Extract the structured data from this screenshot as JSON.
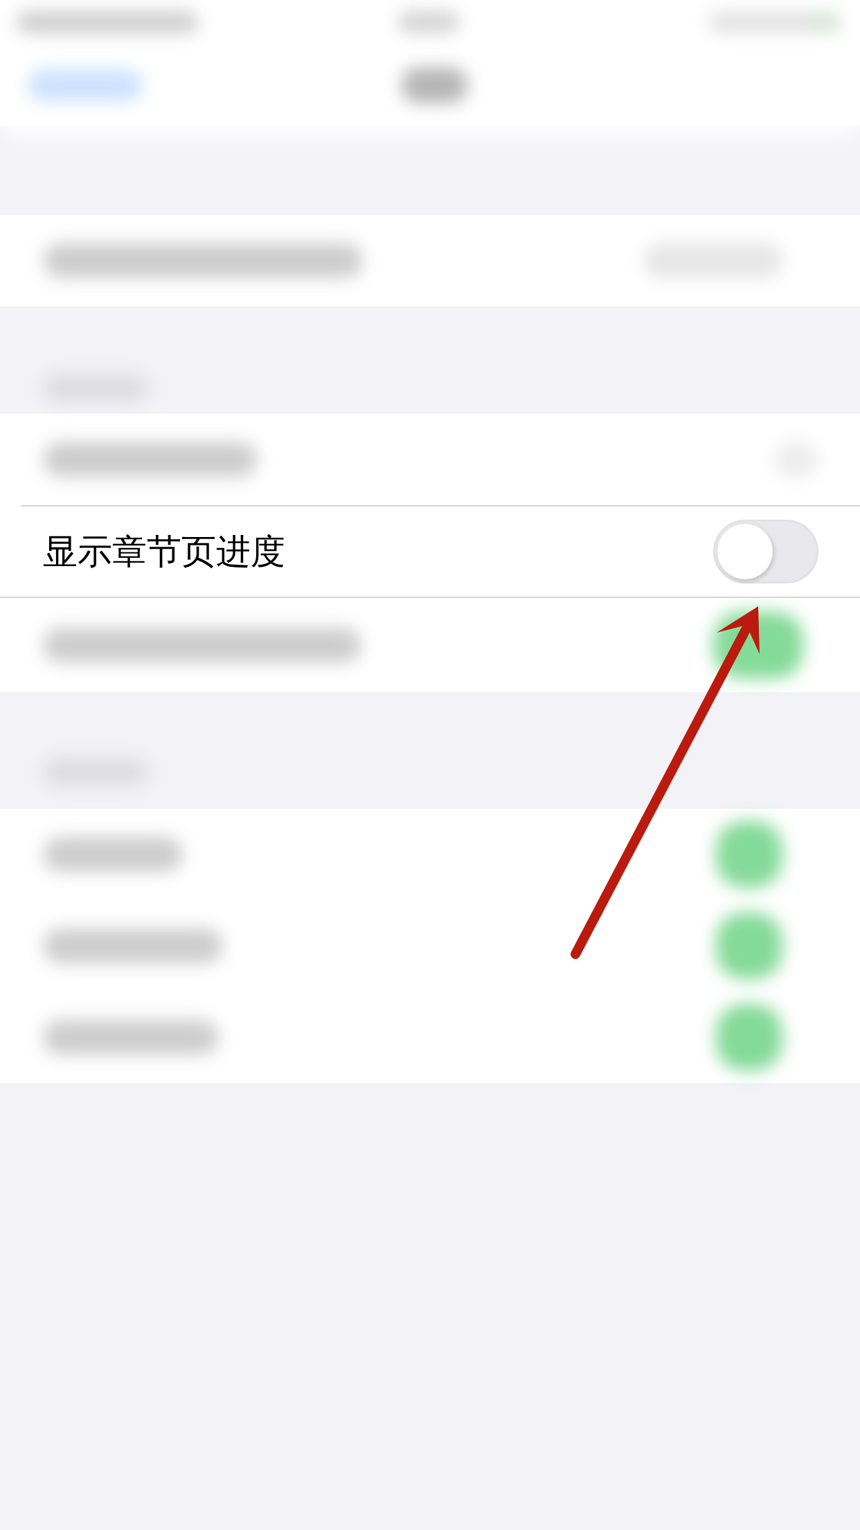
{
  "settings_row": {
    "label": "显示章节页进度",
    "on": false
  },
  "annotation": {
    "kind": "arrow"
  }
}
